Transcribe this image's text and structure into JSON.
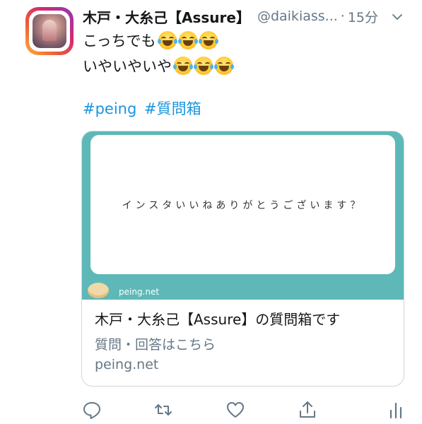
{
  "tweet": {
    "display_name": "木戸・大糸己【Assure】",
    "handle": "@daikiass...",
    "separator": "·",
    "time": "15分",
    "lines": [
      "こっちでも",
      "いやいやいや"
    ],
    "emoji_name": "face-with-tears-of-joy",
    "emoji_per_line": 3,
    "hashtags": [
      "#peing",
      "#質問箱"
    ]
  },
  "card": {
    "question": "インスタいいねありがとうございます？",
    "logo_text": "peing.net",
    "title": "木戸・大糸己【Assure】の質問箱です",
    "description": "質問・回答はこちら",
    "domain": "peing.net"
  },
  "colors": {
    "link": "#1b95e0",
    "card_bg": "#5eb8b8",
    "muted": "#657786"
  },
  "icons": {
    "reply": "speech-bubble-icon",
    "retweet": "retweet-icon",
    "like": "heart-icon",
    "share": "share-icon",
    "analytics": "bar-chart-icon",
    "more": "chevron-down-icon"
  }
}
